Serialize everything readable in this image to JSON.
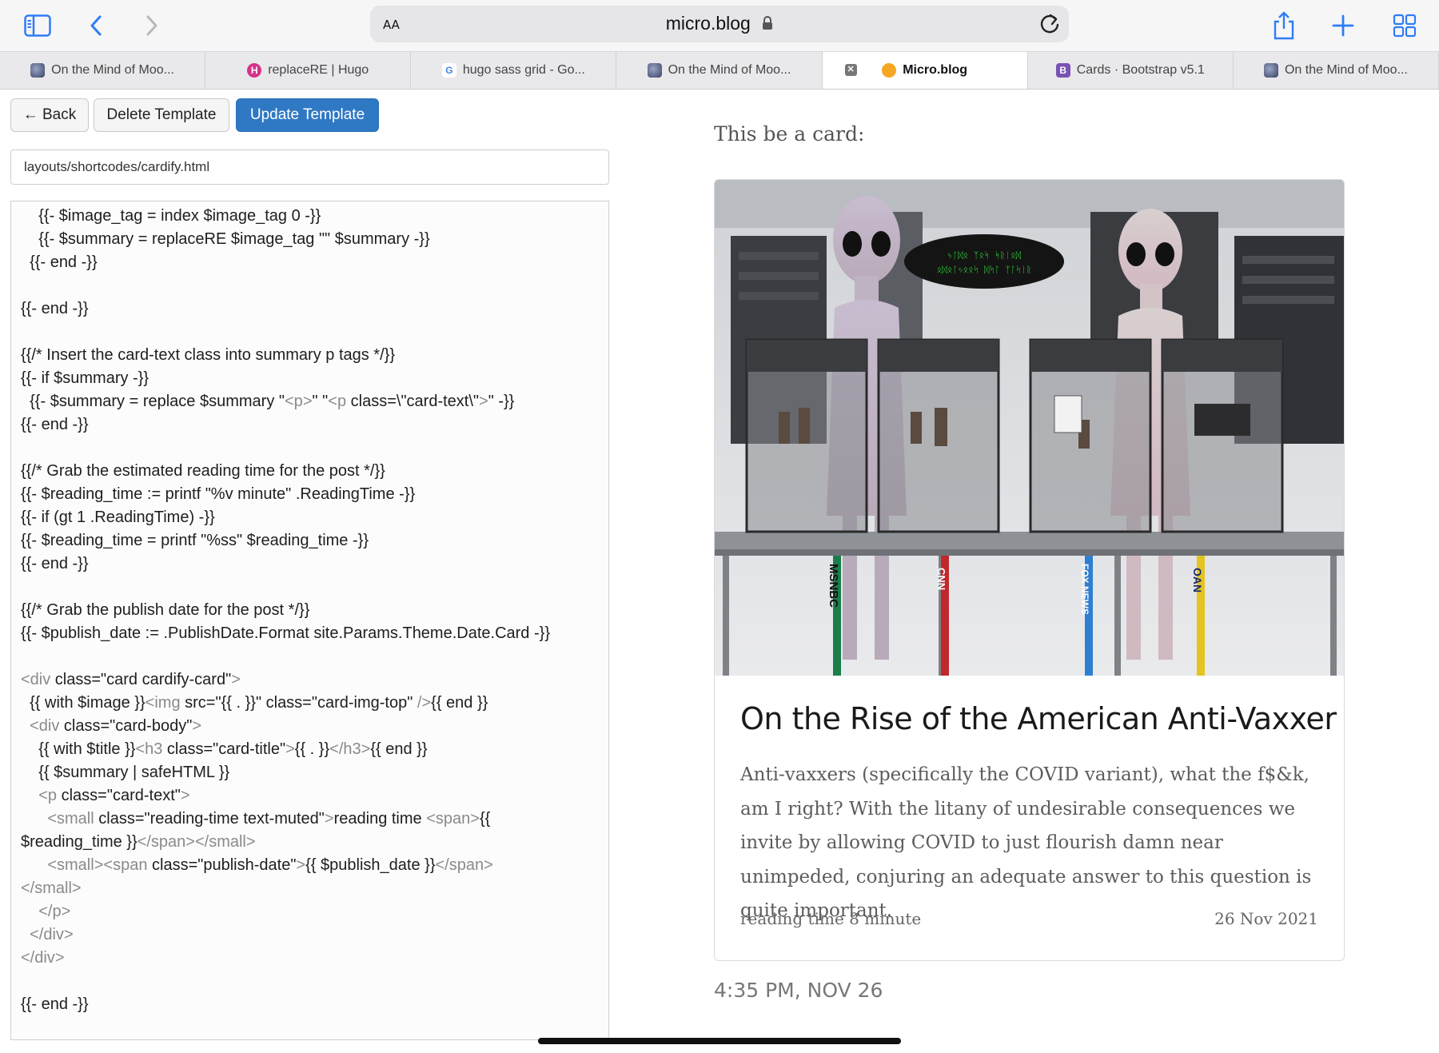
{
  "browser": {
    "text_size_label": "AA",
    "url": "micro.blog"
  },
  "tabs": [
    {
      "label": "On the Mind of Moo...",
      "favicon": "moon-icon",
      "color": "#5a6478"
    },
    {
      "label": "replaceRE | Hugo",
      "favicon": "hugo-icon",
      "color": "#d6338a"
    },
    {
      "label": "hugo sass grid - Go...",
      "favicon": "google-icon",
      "color": "#ffffff"
    },
    {
      "label": "On the Mind of Moo...",
      "favicon": "moon-icon",
      "color": "#5a6478"
    },
    {
      "label": "Micro.blog",
      "favicon": "microblog-icon",
      "color": "#f5a623",
      "active": true
    },
    {
      "label": "Cards · Bootstrap v5.1",
      "favicon": "bootstrap-icon",
      "color": "#7952b3"
    },
    {
      "label": "On the Mind of Moo...",
      "favicon": "moon-icon",
      "color": "#5a6478"
    }
  ],
  "editor": {
    "back_label": "← Back",
    "delete_label": "Delete Template",
    "update_label": "Update Template",
    "path_value": "layouts/shortcodes/cardify.html",
    "code_lines": [
      "    {{- $image_tag = index $image_tag 0 -}}",
      "    {{- $summary = replaceRE $image_tag \"\" $summary -}}",
      "  {{- end -}}",
      "",
      "{{- end -}}",
      "",
      "{{/* Insert the card-text class into summary p tags */}}",
      "{{- if $summary -}}",
      "  {{- $summary = replace $summary \"<p>\" \"<p class=\\\"card-text\\\">\" -}}",
      "{{- end -}}",
      "",
      "{{/* Grab the estimated reading time for the post */}}",
      "{{- $reading_time := printf \"%v minute\" .ReadingTime -}}",
      "{{- if (gt 1 .ReadingTime) -}}",
      "{{- $reading_time = printf \"%ss\" $reading_time -}}",
      "{{- end -}}",
      "",
      "{{/* Grab the publish date for the post */}}",
      "{{- $publish_date := .PublishDate.Format site.Params.Theme.Date.Card -}}",
      "",
      "<div class=\"card cardify-card\">",
      "  {{ with $image }}<img src=\"{{ . }}\" class=\"card-img-top\" />{{ end }}",
      "  <div class=\"card-body\">",
      "    {{ with $title }}<h3 class=\"card-title\">{{ . }}</h3>{{ end }}",
      "    {{ $summary | safeHTML }}",
      "    <p class=\"card-text\">",
      "      <small class=\"reading-time text-muted\">reading time <span>{{",
      "$reading_time }}</span></small>",
      "      <small><span class=\"publish-date\">{{ $publish_date }}</span>",
      "</small>",
      "    </p>",
      "  </div>",
      "</div>",
      "",
      "{{- end -}}"
    ]
  },
  "preview": {
    "lead": "This be a card:",
    "card": {
      "image_labels": [
        "MSNBC",
        "CNN",
        "FOX NEWS",
        "OAN"
      ],
      "title": "On the Rise of the American Anti-Vaxxer",
      "text": "Anti-vaxxers (specifically the COVID variant), what the f$&k, am I right? With the litany of undesirable consequences we invite by allowing COVID to just flourish damn near unimpeded, conjuring an adequate answer to this question is quite important.",
      "reading_time": "reading time 8 minute",
      "publish_date": "26 Nov 2021"
    },
    "timestamp": "4:35 PM, NOV 26"
  }
}
